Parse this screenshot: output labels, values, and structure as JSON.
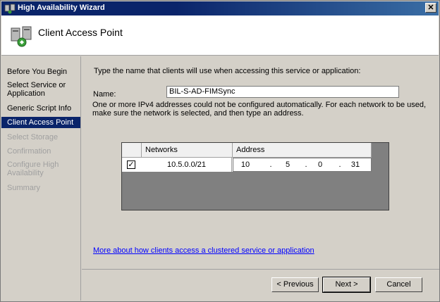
{
  "window": {
    "title": "High Availability Wizard"
  },
  "header": {
    "title": "Client Access Point"
  },
  "sidebar": {
    "items": [
      {
        "label": "Before You Begin",
        "state": "normal"
      },
      {
        "label": "Select Service or Application",
        "state": "normal"
      },
      {
        "label": "Generic Script Info",
        "state": "normal"
      },
      {
        "label": "Client Access Point",
        "state": "active"
      },
      {
        "label": "Select Storage",
        "state": "disabled"
      },
      {
        "label": "Confirmation",
        "state": "disabled"
      },
      {
        "label": "Configure High Availability",
        "state": "disabled"
      },
      {
        "label": "Summary",
        "state": "disabled"
      }
    ]
  },
  "main": {
    "instruction": "Type the name that clients will use when accessing this service or application:",
    "name_label": "Name:",
    "name_value": "BIL-S-AD-FIMSync",
    "warning": "One or more IPv4 addresses could not be configured automatically.  For each network to be used, make sure the network is selected, and then type an address.",
    "grid": {
      "headers": [
        "Networks",
        "Address"
      ],
      "rows": [
        {
          "checked": true,
          "check_glyph": "✓",
          "network": "10.5.0.0/21",
          "octets": [
            "10",
            "5",
            "0",
            "31"
          ]
        }
      ]
    },
    "link": "More about how clients access a clustered service or application"
  },
  "buttons": {
    "previous": "< Previous",
    "next": "Next >",
    "cancel": "Cancel",
    "close_glyph": "✕"
  },
  "colors": {
    "titlebar": "#0a246a",
    "active_item": "#0a246a",
    "link": "#0000ff"
  }
}
